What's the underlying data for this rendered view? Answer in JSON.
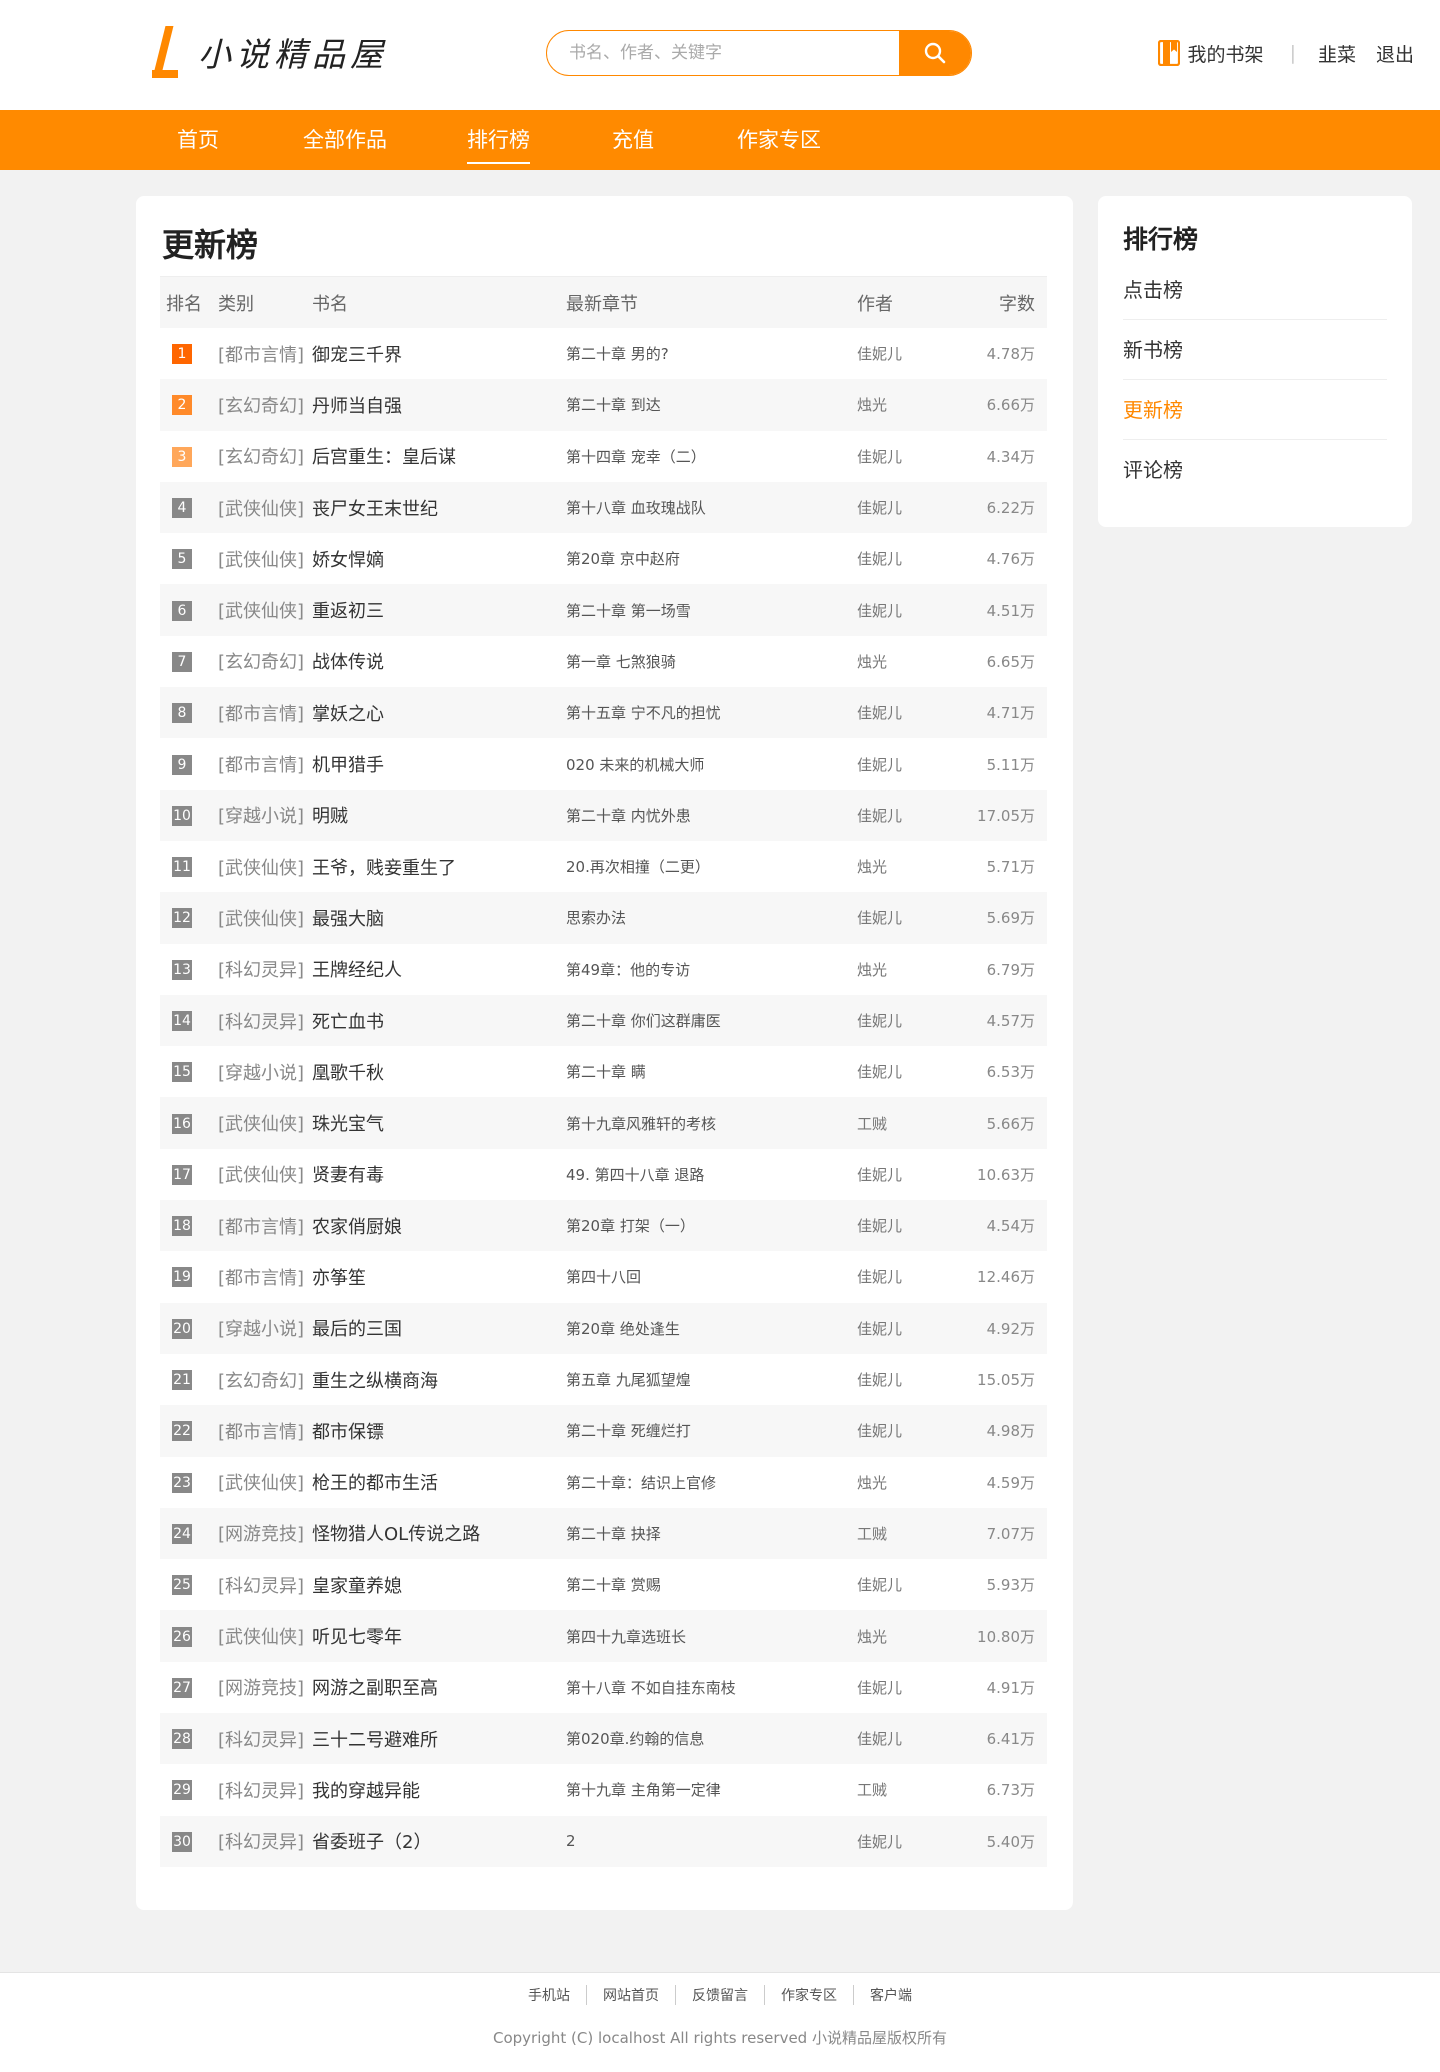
{
  "header": {
    "logo_text": "小说精品屋",
    "search_placeholder": "书名、作者、关键字",
    "bookshelf_label": "我的书架",
    "username": "韭菜",
    "logout_label": "退出"
  },
  "nav": {
    "items": [
      {
        "label": "首页"
      },
      {
        "label": "全部作品"
      },
      {
        "label": "排行榜"
      },
      {
        "label": "充值"
      },
      {
        "label": "作家专区"
      }
    ],
    "active": "排行榜"
  },
  "main": {
    "title": "更新榜",
    "columns": {
      "rank": "排名",
      "type": "类别",
      "name": "书名",
      "chapter": "最新章节",
      "author": "作者",
      "words": "字数"
    },
    "rows": [
      {
        "rank": "1",
        "type": "[都市言情]",
        "name": "御宠三千界",
        "chapter": "第二十章 男的?",
        "author": "佳妮儿",
        "words": "4.78万"
      },
      {
        "rank": "2",
        "type": "[玄幻奇幻]",
        "name": "丹师当自强",
        "chapter": "第二十章 到达",
        "author": "烛光",
        "words": "6.66万"
      },
      {
        "rank": "3",
        "type": "[玄幻奇幻]",
        "name": "后宫重生：皇后谋",
        "chapter": "第十四章 宠幸（二）",
        "author": "佳妮儿",
        "words": "4.34万"
      },
      {
        "rank": "4",
        "type": "[武侠仙侠]",
        "name": "丧尸女王末世纪",
        "chapter": "第十八章 血玫瑰战队",
        "author": "佳妮儿",
        "words": "6.22万"
      },
      {
        "rank": "5",
        "type": "[武侠仙侠]",
        "name": "娇女悍嫡",
        "chapter": "第20章 京中赵府",
        "author": "佳妮儿",
        "words": "4.76万"
      },
      {
        "rank": "6",
        "type": "[武侠仙侠]",
        "name": "重返初三",
        "chapter": "第二十章 第一场雪",
        "author": "佳妮儿",
        "words": "4.51万"
      },
      {
        "rank": "7",
        "type": "[玄幻奇幻]",
        "name": "战体传说",
        "chapter": "第一章 七煞狼骑",
        "author": "烛光",
        "words": "6.65万"
      },
      {
        "rank": "8",
        "type": "[都市言情]",
        "name": "掌妖之心",
        "chapter": "第十五章 宁不凡的担忧",
        "author": "佳妮儿",
        "words": "4.71万"
      },
      {
        "rank": "9",
        "type": "[都市言情]",
        "name": "机甲猎手",
        "chapter": "020 未来的机械大师",
        "author": "佳妮儿",
        "words": "5.11万"
      },
      {
        "rank": "10",
        "type": "[穿越小说]",
        "name": "明贼",
        "chapter": "第二十章 内忧外患",
        "author": "佳妮儿",
        "words": "17.05万"
      },
      {
        "rank": "11",
        "type": "[武侠仙侠]",
        "name": "王爷，贱妾重生了",
        "chapter": "20.再次相撞（二更）",
        "author": "烛光",
        "words": "5.71万"
      },
      {
        "rank": "12",
        "type": "[武侠仙侠]",
        "name": "最强大脑",
        "chapter": "思索办法",
        "author": "佳妮儿",
        "words": "5.69万"
      },
      {
        "rank": "13",
        "type": "[科幻灵异]",
        "name": "王牌经纪人",
        "chapter": "第49章：他的专访",
        "author": "烛光",
        "words": "6.79万"
      },
      {
        "rank": "14",
        "type": "[科幻灵异]",
        "name": "死亡血书",
        "chapter": "第二十章 你们这群庸医",
        "author": "佳妮儿",
        "words": "4.57万"
      },
      {
        "rank": "15",
        "type": "[穿越小说]",
        "name": "凰歌千秋",
        "chapter": "第二十章 瞒",
        "author": "佳妮儿",
        "words": "6.53万"
      },
      {
        "rank": "16",
        "type": "[武侠仙侠]",
        "name": "珠光宝气",
        "chapter": "第十九章风雅轩的考核",
        "author": "工贼",
        "words": "5.66万"
      },
      {
        "rank": "17",
        "type": "[武侠仙侠]",
        "name": "贤妻有毒",
        "chapter": "49. 第四十八章 退路",
        "author": "佳妮儿",
        "words": "10.63万"
      },
      {
        "rank": "18",
        "type": "[都市言情]",
        "name": "农家俏厨娘",
        "chapter": "第20章 打架（一）",
        "author": "佳妮儿",
        "words": "4.54万"
      },
      {
        "rank": "19",
        "type": "[都市言情]",
        "name": "亦筝笙",
        "chapter": "第四十八回",
        "author": "佳妮儿",
        "words": "12.46万"
      },
      {
        "rank": "20",
        "type": "[穿越小说]",
        "name": "最后的三国",
        "chapter": "第20章 绝处逢生",
        "author": "佳妮儿",
        "words": "4.92万"
      },
      {
        "rank": "21",
        "type": "[玄幻奇幻]",
        "name": "重生之纵横商海",
        "chapter": "第五章 九尾狐望煌",
        "author": "佳妮儿",
        "words": "15.05万"
      },
      {
        "rank": "22",
        "type": "[都市言情]",
        "name": "都市保镖",
        "chapter": "第二十章 死缠烂打",
        "author": "佳妮儿",
        "words": "4.98万"
      },
      {
        "rank": "23",
        "type": "[武侠仙侠]",
        "name": "枪王的都市生活",
        "chapter": "第二十章：结识上官修",
        "author": "烛光",
        "words": "4.59万"
      },
      {
        "rank": "24",
        "type": "[网游竞技]",
        "name": "怪物猎人OL传说之路",
        "chapter": "第二十章 抉择",
        "author": "工贼",
        "words": "7.07万"
      },
      {
        "rank": "25",
        "type": "[科幻灵异]",
        "name": "皇家童养媳",
        "chapter": "第二十章 赏赐",
        "author": "佳妮儿",
        "words": "5.93万"
      },
      {
        "rank": "26",
        "type": "[武侠仙侠]",
        "name": "听见七零年",
        "chapter": "第四十九章选班长",
        "author": "烛光",
        "words": "10.80万"
      },
      {
        "rank": "27",
        "type": "[网游竞技]",
        "name": "网游之副职至高",
        "chapter": "第十八章 不如自挂东南枝",
        "author": "佳妮儿",
        "words": "4.91万"
      },
      {
        "rank": "28",
        "type": "[科幻灵异]",
        "name": "三十二号避难所",
        "chapter": "第020章.约翰的信息",
        "author": "佳妮儿",
        "words": "6.41万"
      },
      {
        "rank": "29",
        "type": "[科幻灵异]",
        "name": "我的穿越异能",
        "chapter": "第十九章 主角第一定律",
        "author": "工贼",
        "words": "6.73万"
      },
      {
        "rank": "30",
        "type": "[科幻灵异]",
        "name": "省委班子（2）",
        "chapter": "2",
        "author": "佳妮儿",
        "words": "5.40万"
      }
    ]
  },
  "sidebar": {
    "title": "排行榜",
    "items": [
      {
        "label": "点击榜"
      },
      {
        "label": "新书榜"
      },
      {
        "label": "更新榜"
      },
      {
        "label": "评论榜"
      }
    ],
    "active": "更新榜"
  },
  "footer": {
    "links": [
      {
        "label": "手机站"
      },
      {
        "label": "网站首页"
      },
      {
        "label": "反馈留言"
      },
      {
        "label": "作家专区"
      },
      {
        "label": "客户端"
      }
    ],
    "copyright": "Copyright (C) localhost All rights reserved 小说精品屋版权所有"
  },
  "colors": {
    "accent": "#ff8800",
    "nav_bg": "#ff8a00",
    "rank1": "#ff6600",
    "rank2": "#ff8a2a",
    "rank3": "#ffa75a",
    "rank_other": "#888888"
  },
  "icons": {
    "logo": "logo-l-mark",
    "search": "search-icon",
    "bookshelf": "bookshelf-icon"
  }
}
